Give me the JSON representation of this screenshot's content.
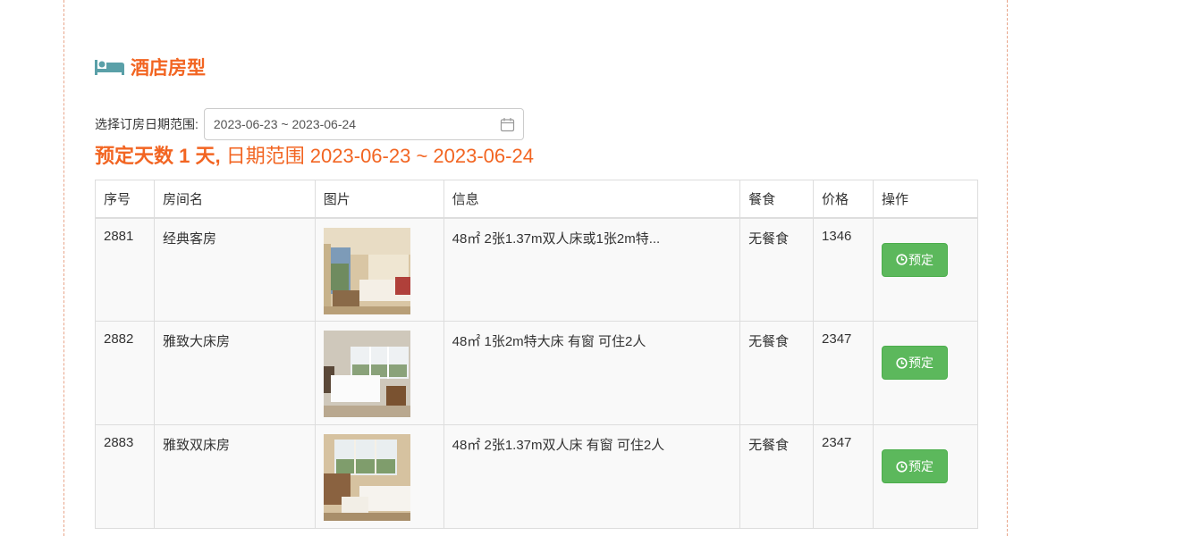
{
  "section": {
    "icon": "bed-icon",
    "title": "酒店房型",
    "accent_color": "#f26522"
  },
  "date_filter": {
    "label": "选择订房日期范围:",
    "value": "2023-06-23 ~ 2023-06-24",
    "icon": "calendar-icon"
  },
  "summary": {
    "days_text": "预定天数 1 天,",
    "range_text": " 日期范围 2023-06-23 ~ 2023-06-24"
  },
  "table": {
    "headers": [
      "序号",
      "房间名",
      "图片",
      "信息",
      "餐食",
      "价格",
      "操作"
    ],
    "rows": [
      {
        "id": "2881",
        "name": "经典客房",
        "info": "48㎡ 2张1.37m双人床或1张2m特...",
        "meal": "无餐食",
        "price": "1346",
        "action": "预定"
      },
      {
        "id": "2882",
        "name": "雅致大床房",
        "info": "48㎡ 1张2m特大床 有窗 可住2人",
        "meal": "无餐食",
        "price": "2347",
        "action": "预定"
      },
      {
        "id": "2883",
        "name": "雅致双床房",
        "info": "48㎡ 2张1.37m双人床 有窗 可住2人",
        "meal": "无餐食",
        "price": "2347",
        "action": "预定"
      }
    ]
  },
  "colors": {
    "button_green": "#5cb85c",
    "border": "#dddddd",
    "row_bg": "#f9f9f9"
  }
}
